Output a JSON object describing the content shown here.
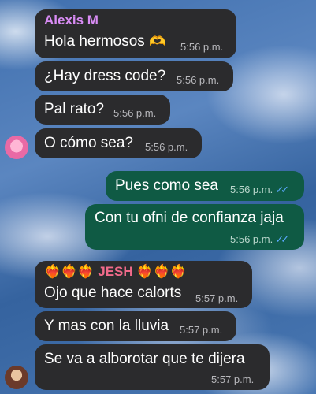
{
  "messages": [
    {
      "sender": "Alexis  M",
      "sender_color": "#d98cf5",
      "text": "Hola hermosos",
      "emoji": "🫶",
      "time": "5:56 p.m.",
      "direction": "in"
    },
    {
      "text": "¿Hay dress code?",
      "time": "5:56 p.m.",
      "direction": "in"
    },
    {
      "text": "Pal rato?",
      "time": "5:56 p.m.",
      "direction": "in"
    },
    {
      "text": "O cómo sea?",
      "time": "5:56 p.m.",
      "direction": "in"
    },
    {
      "text": "Pues como sea",
      "time": "5:56 p.m.",
      "direction": "out",
      "status": "read"
    },
    {
      "text": "Con tu ofni de confianza jaja",
      "time": "5:56 p.m.",
      "direction": "out",
      "status": "read"
    },
    {
      "sender": "JESH",
      "sender_color": "#f06a8a",
      "sender_hearts": "❤️‍🔥❤️‍🔥❤️‍🔥",
      "text": "Ojo que hace calorts",
      "time": "5:57 p.m.",
      "direction": "in"
    },
    {
      "text": "Y mas con la lluvia",
      "time": "5:57 p.m.",
      "direction": "in"
    },
    {
      "text": "Se va a alborotar que te dijera",
      "time": "5:57 p.m.",
      "direction": "in"
    }
  ],
  "read_ticks": "✓✓",
  "colors": {
    "incoming_bubble": "#2b2b2d",
    "outgoing_bubble": "#0f5a44",
    "read_ticks": "#5aa9ff"
  }
}
